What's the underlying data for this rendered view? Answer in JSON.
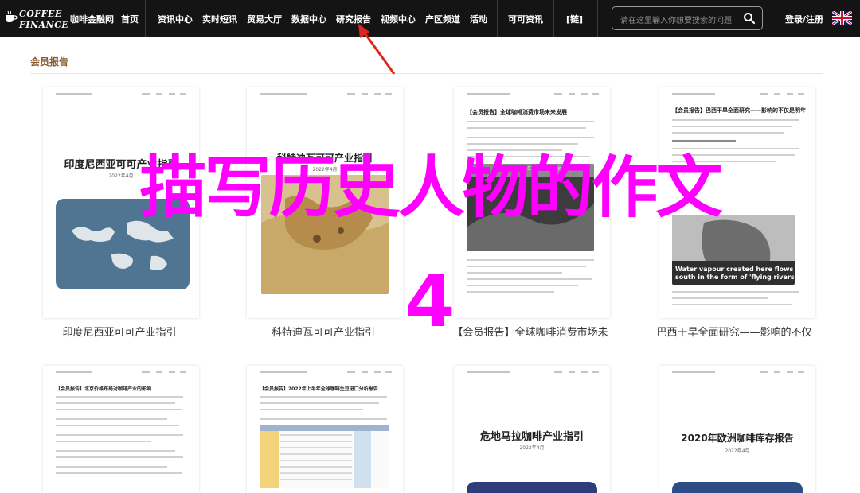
{
  "nav": {
    "logo_line1": "COFFEE",
    "logo_line2": "FINANCE",
    "links": [
      "咖啡金融网",
      "首页",
      "资讯中心",
      "实时短讯",
      "贸易大厅",
      "数据中心",
      "研究报告",
      "视频中心",
      "产区频道",
      "活动",
      "可可资讯",
      "[链]"
    ],
    "search_placeholder": "请在这里输入你想要搜索的问题",
    "auth": "登录/注册"
  },
  "section": {
    "title": "会员报告"
  },
  "cards": [
    {
      "thumb_title": "印度尼西亚可可产业指引",
      "thumb_date": "2022年4月",
      "caption": "印度尼西亚可可产业指引"
    },
    {
      "thumb_title": "科特迪瓦可可产业指引",
      "thumb_date": "2022年4月",
      "caption": "科特迪瓦可可产业指引"
    },
    {
      "thumb_title": "【会员报告】全球咖啡消费市场未来发展",
      "thumb_img_text": "World Coffee Consumption",
      "caption": "【会员报告】全球咖啡消费市场未"
    },
    {
      "thumb_title": "【会员报告】巴西干旱全面研究——影响的不仅是明年",
      "thumb_img_text1": "Water vapour created here flows",
      "thumb_img_text2": "south in the form of 'flying rivers'.",
      "caption": "巴西干旱全面研究——影响的不仅"
    },
    {
      "thumb_title": "【会员报告】北京价格布局对咖啡产业的影响"
    },
    {
      "thumb_title": "【会员报告】2022年上半年全球咖啡生豆进口分析报告"
    },
    {
      "thumb_title": "危地马拉咖啡产业指引",
      "thumb_date": "2022年4月"
    },
    {
      "thumb_title": "2020年欧洲咖啡库存报告",
      "thumb_date": "2022年4月"
    }
  ],
  "overlay": {
    "line1": "描写历史人物的作文",
    "line2": "4"
  },
  "colors": {
    "nav_bg": "#141414",
    "accent": "#8a5a2b",
    "overlay": "#ff00ff",
    "arrow": "#e0261c"
  }
}
